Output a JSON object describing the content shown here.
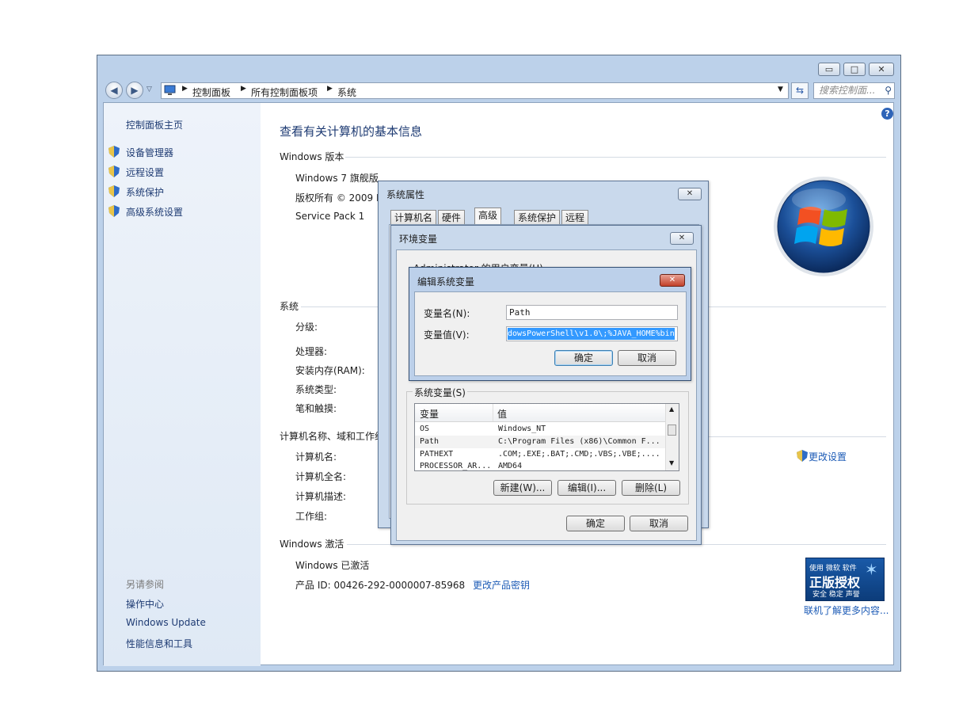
{
  "window": {
    "min_glyph": "▭",
    "max_glyph": "□",
    "close_glyph": "✕"
  },
  "address": {
    "breadcrumbs": [
      "控制面板",
      "所有控制面板项",
      "系统"
    ],
    "search_placeholder": "搜索控制面..."
  },
  "sidebar": {
    "home": "控制面板主页",
    "items": [
      "设备管理器",
      "远程设置",
      "系统保护",
      "高级系统设置"
    ],
    "see_also_title": "另请参阅",
    "see_also": [
      "操作中心",
      "Windows Update",
      "性能信息和工具"
    ]
  },
  "main": {
    "title": "查看有关计算机的基本信息",
    "edition_head": "Windows 版本",
    "edition_name": "Windows 7 旗舰版",
    "copyright": "版权所有 © 2009 I",
    "service_pack": "Service Pack 1",
    "system_head": "系统",
    "system_labels": [
      "分级:",
      "处理器:",
      "安装内存(RAM):",
      "系统类型:",
      "笔和触摸:"
    ],
    "computer_head": "计算机名称、域和工作组",
    "computer_labels": [
      "计算机名:",
      "计算机全名:",
      "计算机描述:",
      "工作组:"
    ],
    "change_settings": "更改设置",
    "activation_head": "Windows 激活",
    "activated": "Windows 已激活",
    "product_id": "产品 ID: 00426-292-0000007-85968",
    "change_key": "更改产品密钥",
    "genuine_top": "使用 微软 软件",
    "genuine_main": "正版授权",
    "genuine_sub": "安全 稳定 声誉",
    "learn_more": "联机了解更多内容..."
  },
  "sysprops": {
    "title": "系统属性",
    "tabs": [
      "计算机名",
      "硬件",
      "高级",
      "系统保护",
      "远程"
    ]
  },
  "envvars": {
    "title": "环境变量",
    "user_vars_label": "Administrator 的用户变量(U)",
    "sys_vars_label": "系统变量(S)",
    "col_var": "变量",
    "col_val": "值",
    "rows": [
      {
        "name": "OS",
        "value": "Windows_NT"
      },
      {
        "name": "Path",
        "value": "C:\\Program Files (x86)\\Common F..."
      },
      {
        "name": "PATHEXT",
        "value": ".COM;.EXE;.BAT;.CMD;.VBS;.VBE;...."
      },
      {
        "name": "PROCESSOR_AR...",
        "value": "AMD64"
      }
    ],
    "new_btn": "新建(W)...",
    "edit_btn": "编辑(I)...",
    "delete_btn": "删除(L)",
    "ok_btn": "确定",
    "cancel_btn": "取消"
  },
  "editvar": {
    "title": "编辑系统变量",
    "name_label": "变量名(N):",
    "name_value": "Path",
    "value_label": "变量值(V):",
    "value_value": "dowsPowerShell\\v1.0\\;%JAVA_HOME%bin",
    "ok_btn": "确定",
    "cancel_btn": "取消"
  }
}
